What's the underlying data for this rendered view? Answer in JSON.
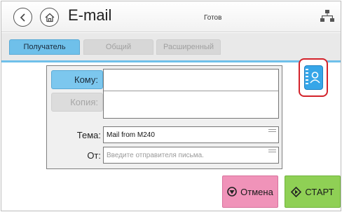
{
  "header": {
    "title": "E-mail",
    "status": "Готов",
    "icons": {
      "back": "back-arrow-icon",
      "home": "home-icon",
      "network": "network-icon"
    }
  },
  "tabs": [
    {
      "label": "Получатель",
      "active": true
    },
    {
      "label": "Общий",
      "active": false
    },
    {
      "label": "Расширенный",
      "active": false
    }
  ],
  "form": {
    "to_label": "Кому:",
    "cc_label": "Копия:",
    "to_value": "",
    "cc_value": "",
    "subject_label": "Тема:",
    "subject_value": "Mail from M240",
    "from_label": "От:",
    "from_placeholder": "Введите отправителя письма."
  },
  "address_book": {
    "icon": "address-book-icon"
  },
  "buttons": {
    "cancel": "Отмена",
    "start": "СТАРТ"
  },
  "colors": {
    "accent": "#6fc0ea",
    "cancel": "#f093b9",
    "start": "#8fd055",
    "highlight": "#d3222a"
  }
}
